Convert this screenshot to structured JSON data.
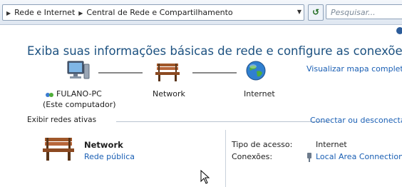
{
  "address_bar": {
    "breadcrumbs": [
      "Rede e Internet",
      "Central de Rede e Compartilhamento"
    ],
    "search_placeholder": "Pesquisar..."
  },
  "main": {
    "title": "Exiba suas informações básicas de rede e configure as conexões",
    "map_link": "Visualizar mapa completo",
    "nodes": [
      {
        "label": "FULANO-PC",
        "sublabel": "(Este computador)",
        "icon": "computer-icon"
      },
      {
        "label": "Network",
        "icon": "bench-icon"
      },
      {
        "label": "Internet",
        "icon": "globe-icon"
      }
    ]
  },
  "active_networks": {
    "section_label": "Exibir redes ativas",
    "connect_link": "Conectar ou desconectar",
    "network": {
      "name": "Network",
      "type": "Rede pública",
      "access_type_label": "Tipo de acesso:",
      "access_type_value": "Internet",
      "connections_label": "Conexões:",
      "connections_value": "Local Area Connection"
    }
  }
}
